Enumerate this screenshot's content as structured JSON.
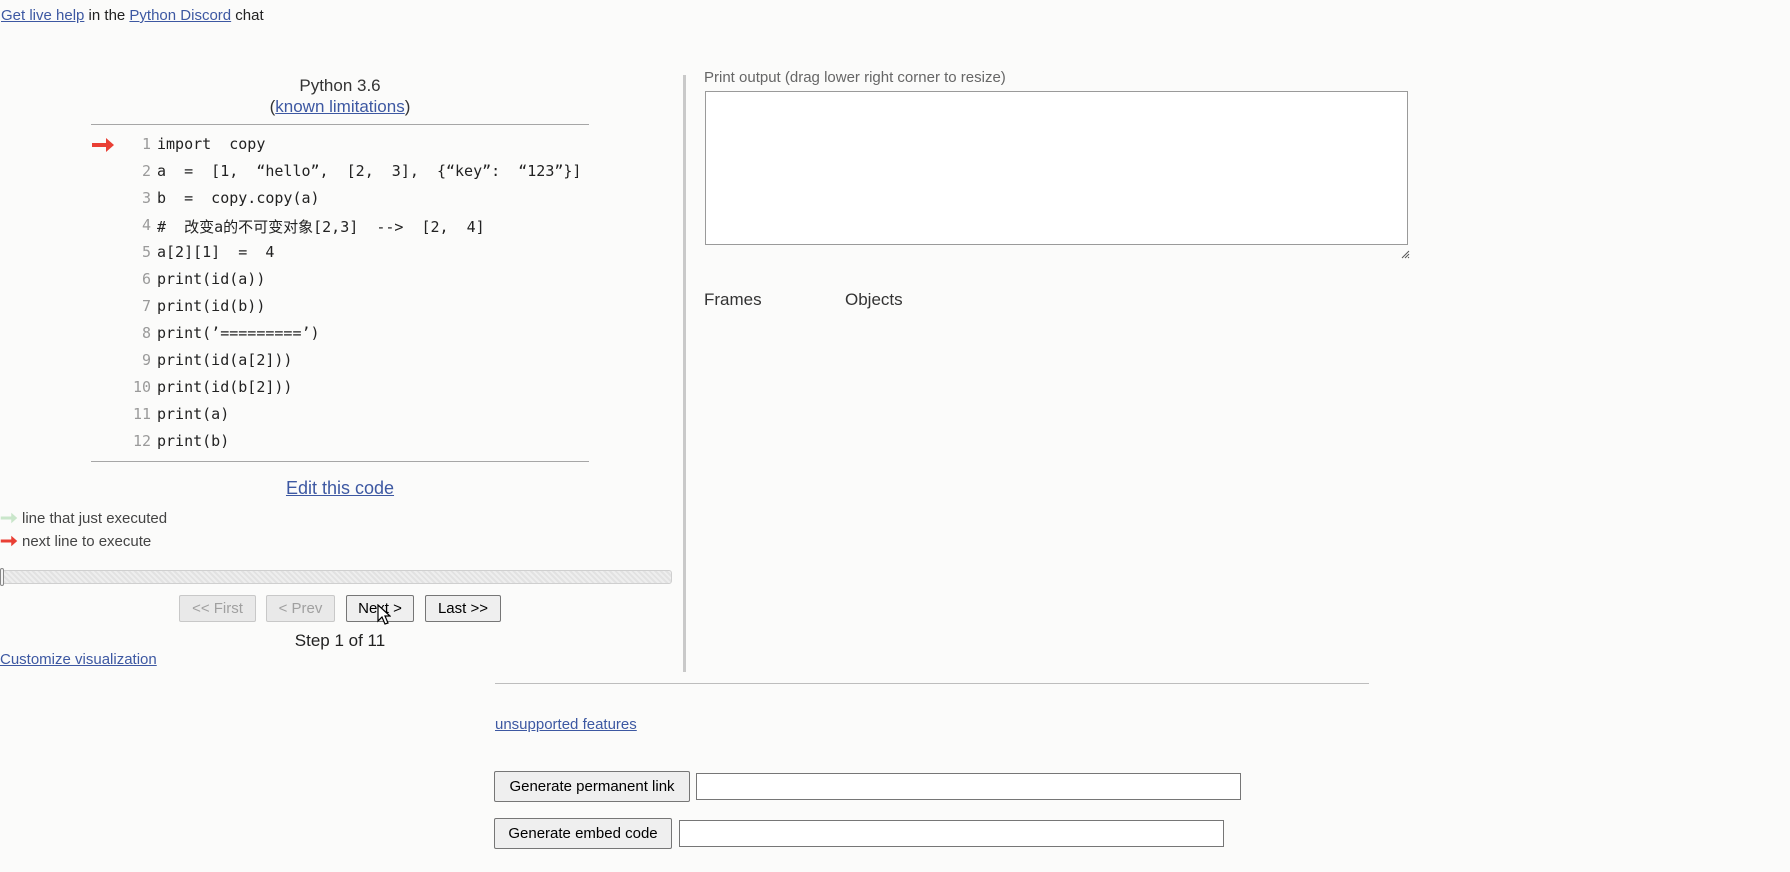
{
  "help_bar": {
    "live_help_link": "Get live help",
    "text_middle": " in the ",
    "discord_link": "Python Discord",
    "text_end": " chat"
  },
  "code_panel": {
    "language": "Python 3.6",
    "paren_open": "(",
    "limitations_link": "known limitations",
    "paren_close": ")",
    "current_line": 1,
    "lines": [
      {
        "no": "1",
        "code": "import  copy"
      },
      {
        "no": "2",
        "code": "a  =  [1,  “hello”,  [2,  3],  {“key”:  “123”}]"
      },
      {
        "no": "3",
        "code": "b  =  copy.copy(a)"
      },
      {
        "no": "4",
        "code": "#  改变a的不可变对象[2,3]  -->  [2,  4]"
      },
      {
        "no": "5",
        "code": "a[2][1]  =  4"
      },
      {
        "no": "6",
        "code": "print(id(a))"
      },
      {
        "no": "7",
        "code": "print(id(b))"
      },
      {
        "no": "8",
        "code": "print(’=========’)"
      },
      {
        "no": "9",
        "code": "print(id(a[2]))"
      },
      {
        "no": "10",
        "code": "print(id(b[2]))"
      },
      {
        "no": "11",
        "code": "print(a)"
      },
      {
        "no": "12",
        "code": "print(b)"
      }
    ],
    "edit_link": "Edit this code"
  },
  "legend": {
    "executed": "line that just executed",
    "next": "next line to execute",
    "executed_color": "#c9e6ca",
    "next_color": "#e93f34"
  },
  "navigation": {
    "progress_fraction": 0,
    "first": "<< First",
    "prev": "< Prev",
    "next": "Next >",
    "last": "Last >>",
    "step_label": "Step 1 of 11",
    "customize_link": "Customize visualization"
  },
  "output_panel": {
    "print_label": "Print output (drag lower right corner to resize)",
    "print_value": "",
    "frames_header": "Frames",
    "objects_header": "Objects"
  },
  "footer": {
    "unsupported_link": "unsupported features",
    "permalink_button": "Generate permanent link",
    "permalink_value": "",
    "embed_button": "Generate embed code",
    "embed_value": ""
  },
  "icons": {
    "next_arrow": "arrow-right-icon",
    "cursor": "mouse-pointer-icon"
  }
}
